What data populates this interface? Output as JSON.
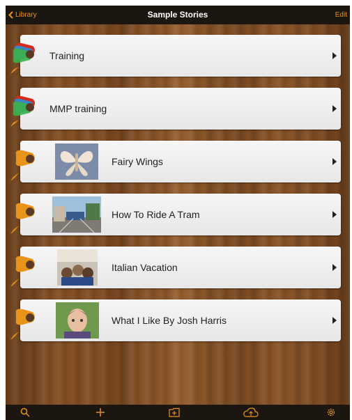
{
  "nav": {
    "back_label": "Library",
    "title": "Sample Stories",
    "edit_label": "Edit"
  },
  "stories": [
    {
      "title": "Training",
      "type": "collection"
    },
    {
      "title": "MMP training",
      "type": "collection"
    },
    {
      "title": "Fairy Wings",
      "type": "story"
    },
    {
      "title": "How To Ride A Tram",
      "type": "story"
    },
    {
      "title": "Italian Vacation",
      "type": "story"
    },
    {
      "title": "What I Like By Josh Harris",
      "type": "story"
    }
  ],
  "toolbar": {
    "icons": [
      "search-icon",
      "add-icon",
      "new-folder-icon",
      "cloud-upload-icon",
      "settings-icon"
    ]
  },
  "colors": {
    "accent": "#e8941a",
    "bar": "#1c1611"
  }
}
